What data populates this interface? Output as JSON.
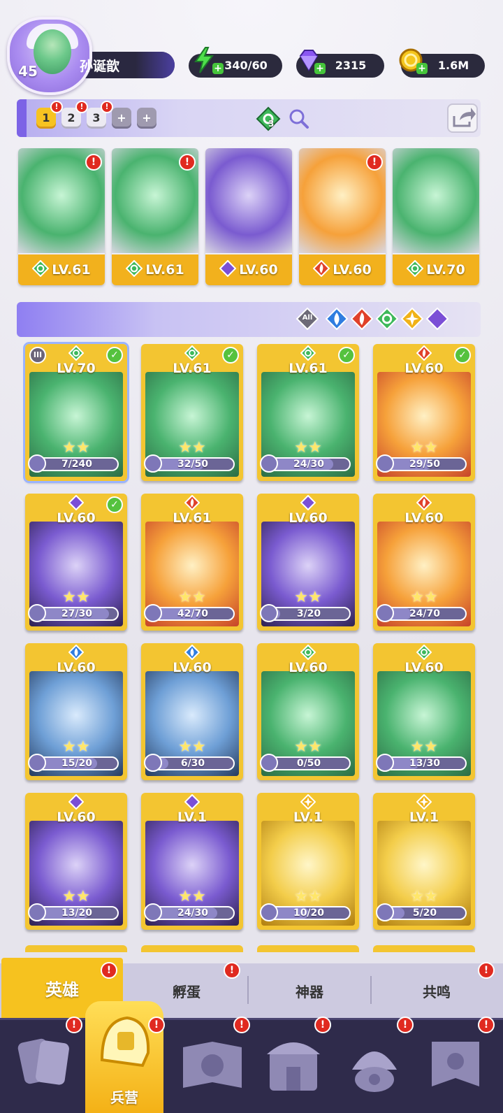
{
  "player": {
    "level": "45",
    "name": "孙诞歆"
  },
  "resources": {
    "energy": "340/60",
    "gems": "2315",
    "gold": "1.6M"
  },
  "teams": {
    "tabs": [
      "1",
      "2",
      "3"
    ],
    "add_labels": [
      "+",
      "+"
    ],
    "power_badge": "3"
  },
  "team_slots": [
    {
      "level": "LV.61",
      "element": "wind",
      "alert": "!"
    },
    {
      "level": "LV.61",
      "element": "wind",
      "alert": "!"
    },
    {
      "level": "LV.60",
      "element": "dark",
      "alert": ""
    },
    {
      "level": "LV.60",
      "element": "fire",
      "alert": "!"
    },
    {
      "level": "LV.70",
      "element": "wind",
      "alert": ""
    }
  ],
  "filter": {
    "all_label": "All",
    "elements": [
      "water",
      "fire",
      "wind",
      "light",
      "dark"
    ]
  },
  "heroes": [
    {
      "level": "LV.70",
      "progress": "7/240",
      "fraction": 0.03,
      "element": "wind"
    },
    {
      "level": "LV.61",
      "progress": "32/50",
      "fraction": 0.64,
      "element": "wind"
    },
    {
      "level": "LV.61",
      "progress": "24/30",
      "fraction": 0.8,
      "element": "wind"
    },
    {
      "level": "LV.60",
      "progress": "29/50",
      "fraction": 0.58,
      "element": "fire"
    },
    {
      "level": "LV.60",
      "progress": "27/30",
      "fraction": 0.9,
      "element": "dark"
    },
    {
      "level": "LV.61",
      "progress": "42/70",
      "fraction": 0.6,
      "element": "fire"
    },
    {
      "level": "LV.60",
      "progress": "3/20",
      "fraction": 0.15,
      "element": "dark"
    },
    {
      "level": "LV.60",
      "progress": "24/70",
      "fraction": 0.34,
      "element": "fire"
    },
    {
      "level": "LV.60",
      "progress": "15/20",
      "fraction": 0.75,
      "element": "water"
    },
    {
      "level": "LV.60",
      "progress": "6/30",
      "fraction": 0.2,
      "element": "water"
    },
    {
      "level": "LV.60",
      "progress": "0/50",
      "fraction": 0.0,
      "element": "wind"
    },
    {
      "level": "LV.60",
      "progress": "13/30",
      "fraction": 0.43,
      "element": "wind"
    },
    {
      "level": "LV.60",
      "progress": "13/20",
      "fraction": 0.65,
      "element": "dark"
    },
    {
      "level": "LV.1",
      "progress": "24/30",
      "fraction": 0.8,
      "element": "dark"
    },
    {
      "level": "LV.1",
      "progress": "10/20",
      "fraction": 0.5,
      "element": "light"
    },
    {
      "level": "LV.1",
      "progress": "5/20",
      "fraction": 0.25,
      "element": "light"
    }
  ],
  "sub_tabs": [
    "英雄",
    "孵蛋",
    "神器",
    "共鸣"
  ],
  "nav": {
    "active_label": "兵营"
  },
  "colors": {
    "wind": "#3db85a",
    "fire": "#e0412a",
    "dark": "#7b4fd6",
    "water": "#2f7de0",
    "light": "#f0b218",
    "card_gold": "#f3c531",
    "accent_purple": "#7c63e6"
  }
}
